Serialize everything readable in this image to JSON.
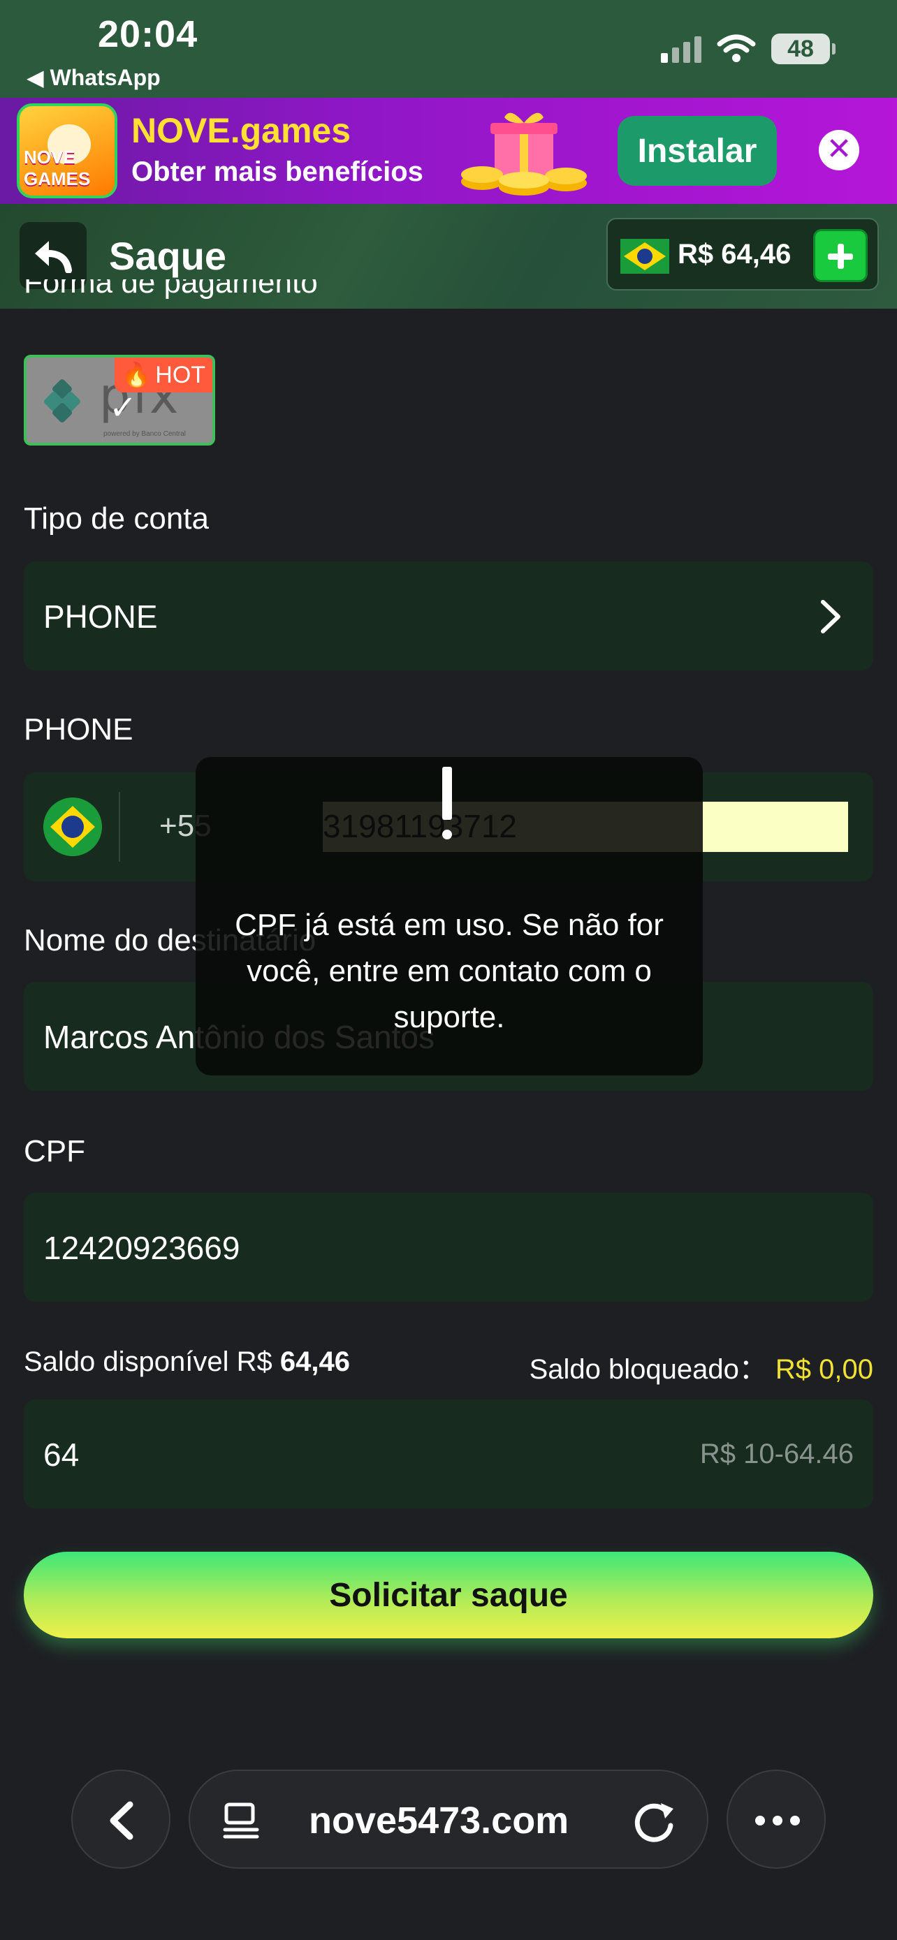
{
  "status_bar": {
    "time": "20:04",
    "back_app": "◀ WhatsApp",
    "battery": "48"
  },
  "promo": {
    "logo_text": "NOVE GAMES",
    "title": "NOVE.games",
    "subtitle": "Obter mais benefícios",
    "install_label": "Instalar"
  },
  "header": {
    "title": "Saque",
    "balance": "R$ 64,46"
  },
  "form": {
    "payment_method_label": "Forma de pagamento",
    "pix": {
      "logo_text": "pix",
      "small_text": "powered by Banco Central",
      "hot_label": "HOT"
    },
    "account_type_label": "Tipo de conta",
    "account_type_value": "PHONE",
    "phone_label": "PHONE",
    "phone_country_code": "+55",
    "phone_value": "31981193712",
    "recipient_label": "Nome do destinatário",
    "recipient_value": "Marcos Antônio dos Santos",
    "cpf_label": "CPF",
    "cpf_value": "12420923669",
    "available_label": "Saldo disponível R$",
    "available_value": "64,46",
    "blocked_label": "Saldo bloqueado：",
    "blocked_value": "R$ 0,00",
    "amount_value": "64",
    "amount_hint": "R$ 10-64.46",
    "submit_label": "Solicitar saque"
  },
  "toast": {
    "message": "CPF já está em uso. Se não for você, entre em contato com o suporte."
  },
  "browser": {
    "url": "nove5473.com"
  },
  "colors": {
    "accent_green": "#19c93e",
    "field_bg": "#172b1f",
    "highlight_yellow": "#f2e233",
    "promo_purple": "#8f17c6"
  }
}
